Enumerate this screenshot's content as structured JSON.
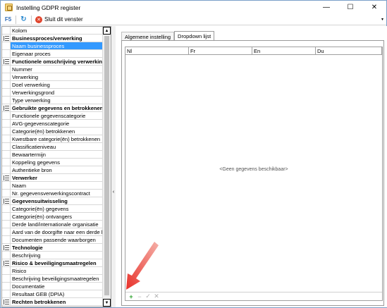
{
  "window": {
    "title": "Instelling GDPR register",
    "minimize_glyph": "—",
    "maximize_glyph": "☐",
    "close_glyph": "✕"
  },
  "toolbar": {
    "icon1": "F5",
    "icon2": "↻",
    "close_label": "Sluit dit venster",
    "close_glyph": "✕",
    "menu_glyph": "▾"
  },
  "left_grid": {
    "header": "Kolom",
    "rows": [
      {
        "label": "Businessproces/verwerking",
        "type": "group"
      },
      {
        "label": "Naam businessproces",
        "type": "item",
        "selected": true
      },
      {
        "label": "Eigenaar proces",
        "type": "item"
      },
      {
        "label": "Functionele omschrijving verwerking",
        "type": "group"
      },
      {
        "label": "Nummer",
        "type": "item"
      },
      {
        "label": "Verwerking",
        "type": "item"
      },
      {
        "label": "Doel verwerking",
        "type": "item"
      },
      {
        "label": "Verwerkingsgrond",
        "type": "item"
      },
      {
        "label": "Type verwerking",
        "type": "item"
      },
      {
        "label": "Gebruikte gegevens en betrokkenen",
        "type": "group"
      },
      {
        "label": "Functionele gegevenscategorie",
        "type": "item"
      },
      {
        "label": "AVG-gegevenscategorie",
        "type": "item"
      },
      {
        "label": "Categorie(ën) betrokkenen",
        "type": "item"
      },
      {
        "label": "Kwestbare categorie(ën) betrokkenen",
        "type": "item"
      },
      {
        "label": "Classificatieniveau",
        "type": "item"
      },
      {
        "label": "Bewaartermijn",
        "type": "item"
      },
      {
        "label": "Koppeling gegevens",
        "type": "item"
      },
      {
        "label": "Authentieke bron",
        "type": "item"
      },
      {
        "label": "Verwerker",
        "type": "group"
      },
      {
        "label": "Naam",
        "type": "item"
      },
      {
        "label": "Nr. gegevensverwerkingscontract",
        "type": "item"
      },
      {
        "label": "Gegevensuitwisseling",
        "type": "group"
      },
      {
        "label": "Categorie(ën) gegevens",
        "type": "item"
      },
      {
        "label": "Categorie(ën) ontvangers",
        "type": "item"
      },
      {
        "label": "Derde land/internationale organisatie",
        "type": "item"
      },
      {
        "label": "Aard van de doorgifte naar een derde land/",
        "type": "item"
      },
      {
        "label": "Documenten passende waarborgen",
        "type": "item"
      },
      {
        "label": "Technologie",
        "type": "group"
      },
      {
        "label": "Beschrijving",
        "type": "item"
      },
      {
        "label": "Risico & beveiligingsmaatregelen",
        "type": "group"
      },
      {
        "label": "Risico",
        "type": "item"
      },
      {
        "label": "Beschrijving beveiligingsmaatregelen",
        "type": "item"
      },
      {
        "label": "Documentatie",
        "type": "item"
      },
      {
        "label": "Resultaat GEB (DPIA)",
        "type": "item"
      },
      {
        "label": "Rechten betrokkenen",
        "type": "group"
      }
    ],
    "scroll_up": "▲",
    "scroll_down": "▼"
  },
  "splitter": {
    "arrow": "‹"
  },
  "tabs": [
    {
      "label": "Algemene instelling",
      "active": false
    },
    {
      "label": "Dropdown lijst",
      "active": true
    }
  ],
  "dropdown_grid": {
    "columns": [
      "Nl",
      "Fr",
      "En",
      "Du"
    ],
    "empty_message": "<Geen gegevens beschikbaar>",
    "footer": {
      "add": "+",
      "remove": "−",
      "confirm": "✓",
      "cancel": "✕"
    }
  },
  "colors": {
    "selection": "#3399ff",
    "annotation_arrow": "#e8312a",
    "add_green": "#2ba02b"
  }
}
